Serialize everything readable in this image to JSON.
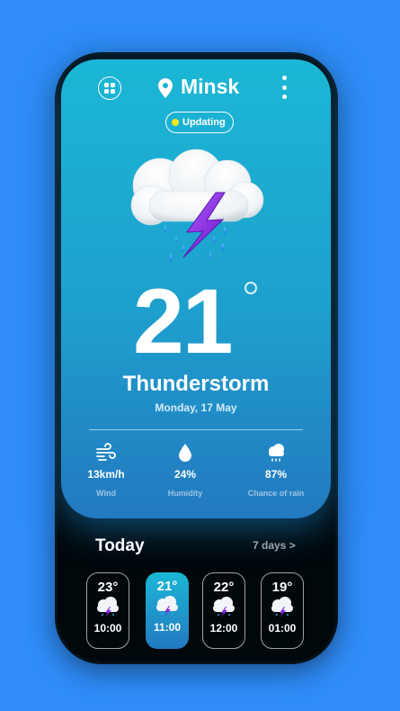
{
  "header": {
    "city": "Minsk",
    "menu_icon": "grid-icon",
    "location_icon": "location-pin-icon",
    "more_icon": "more-vertical-icon"
  },
  "status": {
    "label": "Updating",
    "dot_color": "#f8e71c"
  },
  "current": {
    "temperature": "21",
    "condition": "Thunderstorm",
    "date": "Monday, 17 May",
    "icon": "thunderstorm-icon"
  },
  "stats": [
    {
      "icon": "wind-icon",
      "value": "13km/h",
      "label": "Wind"
    },
    {
      "icon": "humidity-icon",
      "value": "24%",
      "label": "Humidity"
    },
    {
      "icon": "rain-cloud-icon",
      "value": "87%",
      "label": "Chance of rain"
    }
  ],
  "forecast": {
    "title": "Today",
    "more_link": "7 days >",
    "hours": [
      {
        "temp": "23°",
        "time": "10:00",
        "active": false
      },
      {
        "temp": "21°",
        "time": "11:00",
        "active": true
      },
      {
        "temp": "22°",
        "time": "12:00",
        "active": false
      },
      {
        "temp": "19°",
        "time": "01:00",
        "active": false
      }
    ]
  },
  "colors": {
    "background": "#2f8cf8",
    "card_top": "#1bb7d5",
    "card_bottom": "#2379c0",
    "lightning": "#8a2be2"
  }
}
